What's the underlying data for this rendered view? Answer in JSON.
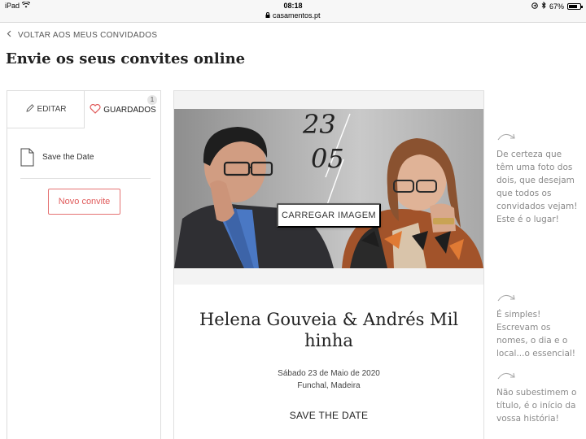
{
  "status_bar": {
    "device": "iPad",
    "time": "08:18",
    "url": "casamentos.pt",
    "battery": "67%"
  },
  "nav": {
    "back_label": "VOLTAR AOS MEUS CONVIDADOS"
  },
  "page": {
    "title": "Envie os seus convites online"
  },
  "sidebar": {
    "tabs": {
      "edit": "EDITAR",
      "saved": "GUARDADOS",
      "saved_count": "1"
    },
    "items": [
      {
        "label": "Save the Date"
      }
    ],
    "new_button": "Novo convite"
  },
  "card": {
    "photo_date": {
      "day": "23",
      "month": "05"
    },
    "upload_button": "CARREGAR IMAGEM",
    "names_line1": "Helena Gouveia & Andrés Mil",
    "names_line2": "hinha",
    "date_text": "Sábado 23 de Maio de 2020",
    "place_text": "Funchal, Madeira",
    "save_the_date": "SAVE THE DATE"
  },
  "tips": [
    {
      "text": "De certeza que têm uma foto dos dois, que desejam que todos os convidados vejam! Este é o lugar!"
    },
    {
      "text": "É simples! Escrevam os nomes, o dia e o local...o essencial!"
    },
    {
      "text": "Não subestimem o título, é o início da vossa história!"
    }
  ],
  "colors": {
    "accent": "#e05a5a",
    "tip_text": "#8a8a8a"
  }
}
